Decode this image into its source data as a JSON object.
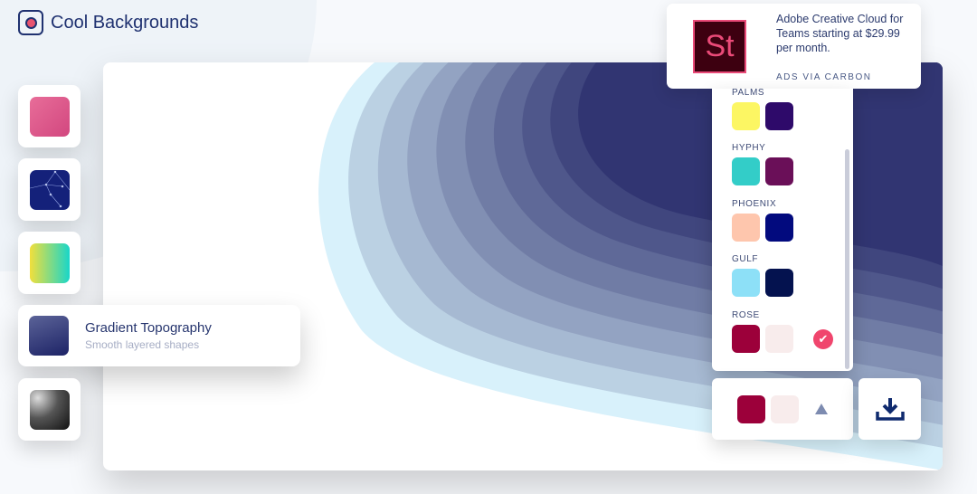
{
  "app": {
    "title": "Cool Backgrounds",
    "logo_icon": "target-icon"
  },
  "sidebar": {
    "items": [
      {
        "name": "low-poly",
        "colors": [
          "#e05a8a",
          "#d44d85"
        ]
      },
      {
        "name": "constellation",
        "colors": [
          "#16237a",
          "#0e1a66"
        ]
      },
      {
        "name": "gradient",
        "colors": [
          "#f1df3c",
          "#19d6c9"
        ]
      },
      {
        "name": "topography",
        "title": "Gradient Topography",
        "subtitle": "Smooth layered shapes",
        "active": true
      },
      {
        "name": "waves",
        "colors": [
          "#cfcfcf",
          "#111111"
        ]
      }
    ]
  },
  "ad": {
    "logo_text": "St",
    "text": "Adobe Creative Cloud for Teams starting at $29.99 per month.",
    "via": "ADS VIA CARBON"
  },
  "palettes": [
    {
      "name": "PALMS",
      "colors": [
        "#fcf663",
        "#2e0a6a"
      ]
    },
    {
      "name": "HYPHY",
      "colors": [
        "#33cdc8",
        "#6a0f58"
      ]
    },
    {
      "name": "PHOENIX",
      "colors": [
        "#fec6ad",
        "#020a7e"
      ]
    },
    {
      "name": "GULF",
      "colors": [
        "#8de0f7",
        "#04124f"
      ]
    },
    {
      "name": "ROSE",
      "colors": [
        "#9c003a",
        "#f8ecec"
      ],
      "selected": true
    }
  ],
  "current": {
    "colors": [
      "#9c003a",
      "#f8ecec"
    ],
    "toggle_icon": "triangle-up-icon"
  },
  "download": {
    "icon": "download-icon"
  },
  "canvas": {
    "from": "#d8f1fb",
    "to": "#313572"
  }
}
